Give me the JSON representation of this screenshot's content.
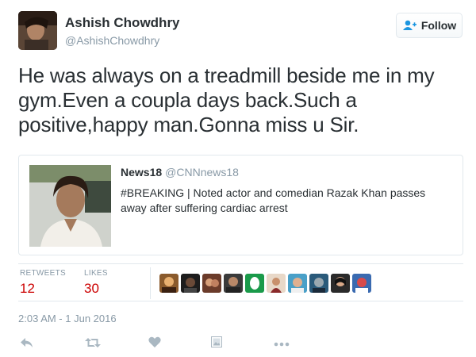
{
  "author": {
    "name": "Ashish Chowdhry",
    "handle": "@AshishChowdhry"
  },
  "follow_button": {
    "label": "Follow",
    "icon": "add-user-icon"
  },
  "tweet": {
    "text": "He was always on a treadmill beside me in my gym.Even a coupla days back.Such a positive,happy man.Gonna miss u Sir."
  },
  "quoted_tweet": {
    "name": "News18",
    "handle": "@CNNnews18",
    "text": "#BREAKING | Noted actor and comedian Razak Khan passes away after suffering cardiac arrest"
  },
  "stats": {
    "retweets_label": "RETWEETS",
    "retweets_count": "12",
    "likes_label": "LIKES",
    "likes_count": "30"
  },
  "liker_avatar_count": 10,
  "timestamp": "2:03 AM - 1 Jun 2016",
  "actions": [
    {
      "name": "reply-icon"
    },
    {
      "name": "retweet-icon"
    },
    {
      "name": "like-icon"
    },
    {
      "name": "reply-image-icon"
    },
    {
      "name": "more-icon"
    }
  ],
  "colors": {
    "count_red": "#cc0000",
    "muted_gray": "#8899a6",
    "text": "#292f33",
    "follow_blue": "#1b95e0"
  }
}
